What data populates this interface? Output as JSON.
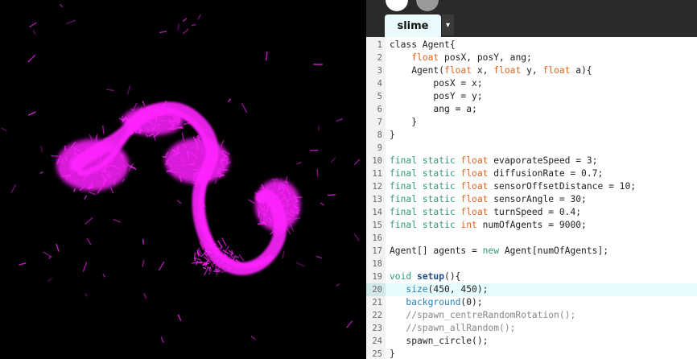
{
  "tabs": [
    {
      "label": "slime",
      "active": true
    }
  ],
  "tab_menu_icon": "▾",
  "toolbar": {
    "run_icon": "circle-white",
    "stop_icon": "circle-gray"
  },
  "highlighted_line": 20,
  "code_lines": [
    {
      "n": "1",
      "tokens": [
        {
          "t": "class Agent{",
          "c": ""
        }
      ]
    },
    {
      "n": "2",
      "tokens": [
        {
          "t": "    ",
          "c": ""
        },
        {
          "t": "float",
          "c": "ty"
        },
        {
          "t": " posX, posY, ang;",
          "c": ""
        }
      ]
    },
    {
      "n": "3",
      "tokens": [
        {
          "t": "    Agent(",
          "c": ""
        },
        {
          "t": "float",
          "c": "ty"
        },
        {
          "t": " x, ",
          "c": ""
        },
        {
          "t": "float",
          "c": "ty"
        },
        {
          "t": " y, ",
          "c": ""
        },
        {
          "t": "float",
          "c": "ty"
        },
        {
          "t": " a){",
          "c": ""
        }
      ]
    },
    {
      "n": "4",
      "tokens": [
        {
          "t": "        posX = x;",
          "c": ""
        }
      ]
    },
    {
      "n": "5",
      "tokens": [
        {
          "t": "        posY = y;",
          "c": ""
        }
      ]
    },
    {
      "n": "6",
      "tokens": [
        {
          "t": "        ang = a;",
          "c": ""
        }
      ]
    },
    {
      "n": "7",
      "tokens": [
        {
          "t": "    }",
          "c": ""
        }
      ]
    },
    {
      "n": "8",
      "tokens": [
        {
          "t": "}",
          "c": ""
        }
      ]
    },
    {
      "n": "9",
      "tokens": []
    },
    {
      "n": "10",
      "tokens": [
        {
          "t": "final static ",
          "c": "kw"
        },
        {
          "t": "float",
          "c": "ty"
        },
        {
          "t": " evaporateSpeed = 3;",
          "c": ""
        }
      ]
    },
    {
      "n": "11",
      "tokens": [
        {
          "t": "final static ",
          "c": "kw"
        },
        {
          "t": "float",
          "c": "ty"
        },
        {
          "t": " diffusionRate = 0.7;",
          "c": ""
        }
      ]
    },
    {
      "n": "12",
      "tokens": [
        {
          "t": "final static ",
          "c": "kw"
        },
        {
          "t": "float",
          "c": "ty"
        },
        {
          "t": " sensorOffsetDistance = 10;",
          "c": ""
        }
      ]
    },
    {
      "n": "13",
      "tokens": [
        {
          "t": "final static ",
          "c": "kw"
        },
        {
          "t": "float",
          "c": "ty"
        },
        {
          "t": " sensorAngle = 30;",
          "c": ""
        }
      ]
    },
    {
      "n": "14",
      "tokens": [
        {
          "t": "final static ",
          "c": "kw"
        },
        {
          "t": "float",
          "c": "ty"
        },
        {
          "t": " turnSpeed = 0.4;",
          "c": ""
        }
      ]
    },
    {
      "n": "15",
      "tokens": [
        {
          "t": "final static ",
          "c": "kw"
        },
        {
          "t": "int",
          "c": "ty"
        },
        {
          "t": " numOfAgents = 9000;",
          "c": ""
        }
      ]
    },
    {
      "n": "16",
      "tokens": []
    },
    {
      "n": "17",
      "tokens": [
        {
          "t": "Agent[] agents = ",
          "c": ""
        },
        {
          "t": "new",
          "c": "kw"
        },
        {
          "t": " Agent[numOfAgents];",
          "c": ""
        }
      ]
    },
    {
      "n": "18",
      "tokens": []
    },
    {
      "n": "19",
      "tokens": [
        {
          "t": "void ",
          "c": "kw"
        },
        {
          "t": "setup",
          "c": "fn"
        },
        {
          "t": "(){",
          "c": ""
        }
      ]
    },
    {
      "n": "20",
      "tokens": [
        {
          "t": "   ",
          "c": ""
        },
        {
          "t": "size",
          "c": "bi"
        },
        {
          "t": "(450, 450);",
          "c": ""
        }
      ]
    },
    {
      "n": "21",
      "tokens": [
        {
          "t": "   ",
          "c": ""
        },
        {
          "t": "background",
          "c": "bi"
        },
        {
          "t": "(0);",
          "c": ""
        }
      ]
    },
    {
      "n": "22",
      "tokens": [
        {
          "t": "   ",
          "c": ""
        },
        {
          "t": "//spawn_centreRandomRotation();",
          "c": "cm"
        }
      ]
    },
    {
      "n": "23",
      "tokens": [
        {
          "t": "   ",
          "c": ""
        },
        {
          "t": "//spawn_allRandom();",
          "c": "cm"
        }
      ]
    },
    {
      "n": "24",
      "tokens": [
        {
          "t": "   spawn_circle();",
          "c": ""
        }
      ]
    },
    {
      "n": "25",
      "tokens": [
        {
          "t": "}",
          "c": ""
        }
      ]
    }
  ],
  "colors": {
    "slime": "#ff1fff",
    "canvas_bg": "#000000",
    "editor_bg": "#ffffff",
    "highlight": "#e6fbfc"
  }
}
